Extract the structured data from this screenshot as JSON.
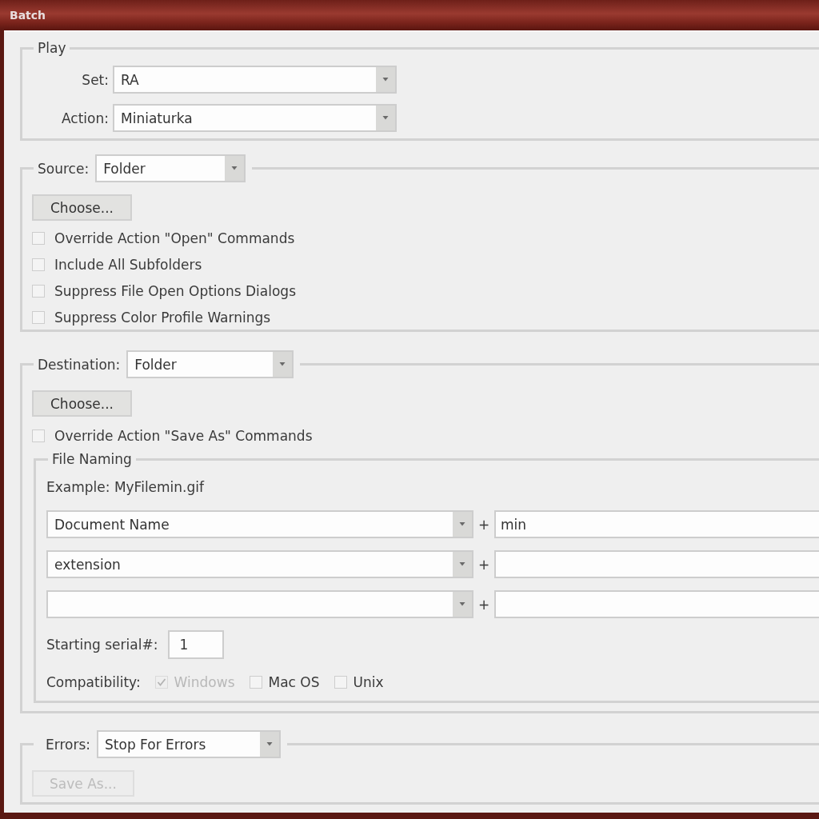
{
  "window": {
    "title": "Batch"
  },
  "play": {
    "label": "Play",
    "fields": [
      {
        "label": "Set:",
        "value": "RA"
      },
      {
        "label": "Action:",
        "value": "Miniaturka"
      }
    ]
  },
  "source": {
    "label": "Source:",
    "value": "Folder",
    "choose_button": {
      "label": "Choose...",
      "disabled": false
    },
    "options": [
      {
        "label": "Override Action \"Open\" Commands",
        "checked": false
      },
      {
        "label": "Include All Subfolders",
        "checked": false
      },
      {
        "label": "Suppress File Open Options Dialogs",
        "checked": false
      },
      {
        "label": "Suppress Color Profile Warnings",
        "checked": false
      }
    ]
  },
  "destination": {
    "label": "Destination:",
    "value": "Folder",
    "choose_button": {
      "label": "Choose...",
      "disabled": false
    },
    "options": [
      {
        "label": "Override Action \"Save As\" Commands",
        "checked": false
      }
    ],
    "file_naming": {
      "label": "File Naming",
      "example": "Example: MyFilemin.gif",
      "rows": [
        {
          "value": "Document Name",
          "plus": "+",
          "suffix": "min"
        },
        {
          "value": "extension",
          "plus": "+"
        },
        {
          "plus": "+"
        }
      ],
      "serial": {
        "label": "Starting serial#:",
        "value": "1"
      },
      "compatibility": {
        "label": "Compatibility:",
        "options": [
          {
            "label": "Windows",
            "checked": true,
            "disabled": true
          },
          {
            "label": "Mac OS",
            "checked": false,
            "disabled": false
          },
          {
            "label": "Unix",
            "checked": false,
            "disabled": false
          }
        ]
      }
    }
  },
  "errors": {
    "label": "Errors:",
    "value": "Stop For Errors",
    "save_as_button": {
      "label": "Save As...",
      "disabled": true
    }
  }
}
